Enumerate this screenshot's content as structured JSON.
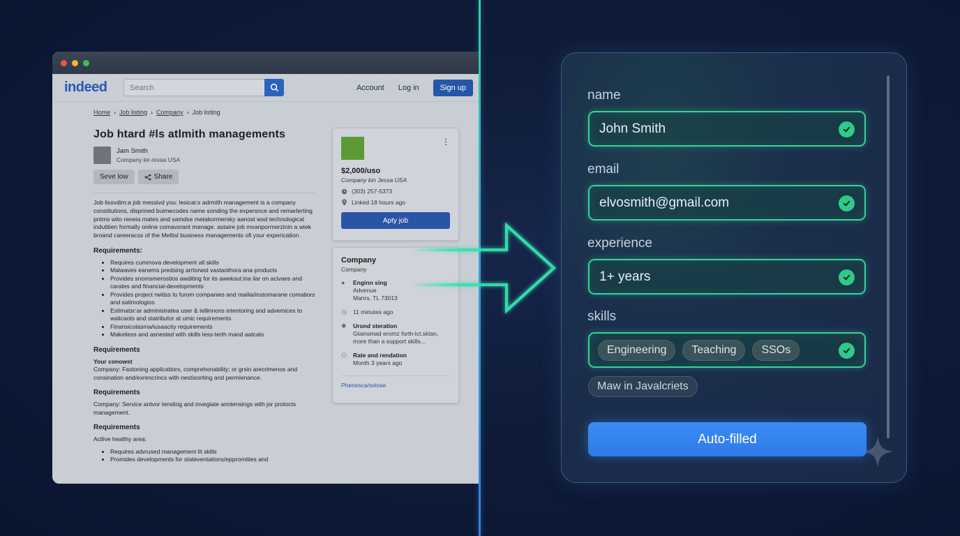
{
  "browser": {
    "logo": "indeed",
    "search_placeholder": "Search",
    "nav": {
      "account": "Account",
      "login": "Log in",
      "signup": "Sign up"
    },
    "breadcrumb": [
      "Home",
      "Job listing",
      "Company",
      "Job listing"
    ],
    "job": {
      "title": "Job htard #ls atlmith managements",
      "poster_name": "Jam Smith",
      "poster_location": "Company kir-/exaa USA",
      "save_label": "Seve low",
      "share_label": "Share",
      "description": "Job lissvdim:a job messivd you: lesicai:s adrmith management is a company constitutions, disprined buimecodes name sonding the expersnce and remarlerting pntms wito reneia mates and samdse metakormersky aanost wsd technological indutitien formally online comavsrant manage. astaire job mvanpormerzinin a wiek broand careeracss of the Meltisl business managements ofi your experication.",
      "sections": [
        {
          "heading": "Requirements:",
          "bullets": [
            "Requires cummova development all skills",
            "Malwaves eanems predsing arrtorwst vastaothora ana products",
            "Provides snomsmerostios awditing for its awekout:ina ilar on acivaes and carates and financial-developments",
            "Provides project rwitiss to furom companies and mailia/instomarane comatiors and satimologios",
            "Estimatsr:ar administratea user & tellinnons intentoring and advemices to walicaots and statributor at umic requirements",
            "Finansicolasma/iusaacity requirements",
            "Makeliess and asnested with skills less-terth mand aatcats"
          ]
        },
        {
          "heading": "Requirements",
          "lead": "Your conowst",
          "text": "Company: Fastoning applicattors, comprehonability; or grsin arecrimenos and consination and/exrencrincs with nestisoriting and permienance."
        },
        {
          "heading": "Requirements",
          "text": "Company: Service antvor tensliog and invegiate anntensings with jor protocts management."
        },
        {
          "heading": "Requirements",
          "text": "Acilive healthy area:",
          "bullets": [
            "Requires advrused management lit skills",
            "Promides developments for stateventations/epprornities and"
          ]
        }
      ]
    },
    "job_card": {
      "salary": "$2,000/uso",
      "location": "Company kin Jessa USA",
      "phone": "(303) 257-5373",
      "posted": "Linked 18 hours ago",
      "apply_label": "Apty job"
    },
    "company_card": {
      "title": "Company",
      "subtitle": "Company",
      "address_title": "Enginn sing",
      "address_line1": "Advenue",
      "address_line2": "Manrs, TL 73013",
      "time": "11 minutes ago",
      "ops_title": "Urond steration",
      "ops_text": "Glainsmad eromz forth-lct.sktan, more than a support skills...",
      "rate_title": "Rate and rendation",
      "rate_text": "Month 3 years ago",
      "link": "Phenesca/sviose"
    }
  },
  "form": {
    "name_label": "name",
    "name_value": "John Smith",
    "email_label": "email",
    "email_value": "elvosmith@gmail.com",
    "experience_label": "experience",
    "experience_value": "1+ years",
    "skills_label": "skills",
    "skills": [
      "Engineering",
      "Teaching",
      "SSOs"
    ],
    "extra_skill": "Maw in Javalcriets",
    "autofill_label": "Auto-filled"
  },
  "colors": {
    "accent_green": "#34d49a",
    "accent_blue": "#3a8cf5",
    "indeed_blue": "#2a56b8"
  }
}
